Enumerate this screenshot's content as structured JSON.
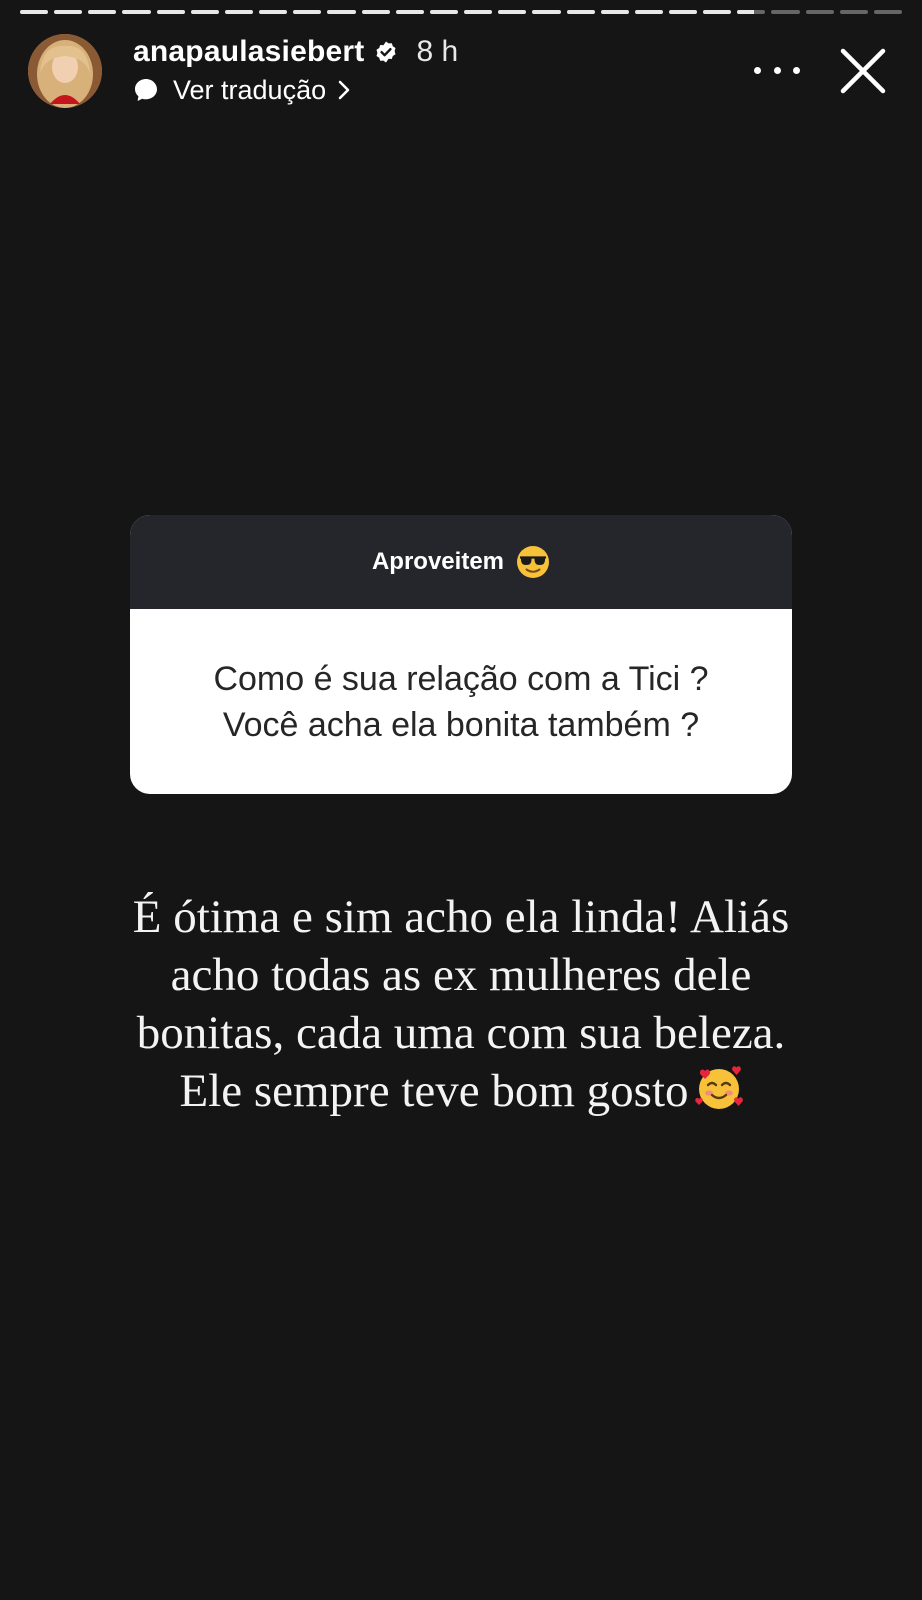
{
  "story": {
    "segments_total": 26,
    "segments_viewed": 21,
    "current_segment_progress": 0.6
  },
  "header": {
    "username": "anapaulasiebert",
    "timestamp": "8 h",
    "translate_label": "Ver tradução",
    "verified": true
  },
  "question_sticker": {
    "title": "Aproveitem",
    "title_emoji": "smiling-face-with-sunglasses",
    "question_line1": "Como é sua relação com a Tici ?",
    "question_line2": "Você acha ela bonita também ?"
  },
  "answer": {
    "line1": "É ótima e sim acho ela linda! Aliás",
    "line2": "acho todas as ex mulheres dele",
    "line3": "bonitas, cada uma com sua beleza.",
    "line4": "Ele sempre teve bom gosto",
    "end_emoji": "smiling-face-with-hearts"
  },
  "colors": {
    "background": "#151515",
    "card_header": "#24262b",
    "card_body": "#ffffff",
    "question_text": "#262626",
    "verified_badge": "#ffffff"
  }
}
